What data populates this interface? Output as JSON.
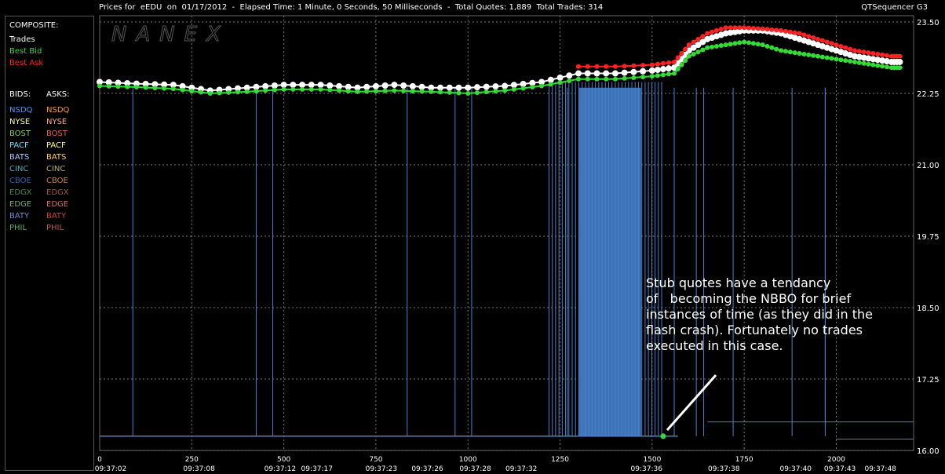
{
  "header": {
    "prices_for": "Prices for  eEDU  on  01/17/2012  -  Elapsed Time: 1 Minute, 0 Seconds, 50 Milliseconds  -  Total Quotes: 1,889  Total Trades: 314",
    "app_name": "QTSequencer G3"
  },
  "watermark": "NANEX",
  "legend": {
    "composite_label": "COMPOSITE:",
    "composite": [
      {
        "label": "Trades",
        "color": "#ffffff"
      },
      {
        "label": "Best Bid",
        "color": "#33dd33"
      },
      {
        "label": "Best Ask",
        "color": "#ff2222"
      }
    ],
    "bids_label": "BIDS:",
    "asks_label": "ASKS:",
    "exchanges": [
      {
        "bid": "NSDQ",
        "bid_color": "#5599ff",
        "ask": "NSDQ",
        "ask_color": "#ff9933"
      },
      {
        "bid": "NYSE",
        "bid_color": "#ffff99",
        "ask": "NYSE",
        "ask_color": "#ffaa88"
      },
      {
        "bid": "BOST",
        "bid_color": "#88cc55",
        "ask": "BOST",
        "ask_color": "#dd6655"
      },
      {
        "bid": "PACF",
        "bid_color": "#66ddff",
        "ask": "PACF",
        "ask_color": "#ffff66"
      },
      {
        "bid": "BATS",
        "bid_color": "#aaccff",
        "ask": "BATS",
        "ask_color": "#ffcc66"
      },
      {
        "bid": "CINC",
        "bid_color": "#55aabb",
        "ask": "CINC",
        "ask_color": "#bbaa66"
      },
      {
        "bid": "CBOE",
        "bid_color": "#3366aa",
        "ask": "CBOE",
        "ask_color": "#cc8833"
      },
      {
        "bid": "EDGX",
        "bid_color": "#448844",
        "ask": "EDGX",
        "ask_color": "#aa5533"
      },
      {
        "bid": "EDGE",
        "bid_color": "#77aa88",
        "ask": "EDGE",
        "ask_color": "#cc7766"
      },
      {
        "bid": "BATY",
        "bid_color": "#7788dd",
        "ask": "BATY",
        "ask_color": "#cc4433"
      },
      {
        "bid": "PHIL",
        "bid_color": "#66aa66",
        "ask": "PHIL",
        "ask_color": "#bb5555"
      }
    ]
  },
  "annotation": "Stub quotes have a tendancy\nof   becoming the NBBO for brief\ninstances of time (as they did in the\nflash crash). Fortunately no trades\nexecuted in this case.",
  "chart_data": {
    "type": "line",
    "ylim": [
      16.0,
      23.5
    ],
    "y_ticks": [
      "23.50",
      "22.25",
      "21.00",
      "19.75",
      "18.50",
      "17.25",
      "16.00"
    ],
    "y_tick_values": [
      23.5,
      22.25,
      21.0,
      19.75,
      18.5,
      17.25,
      16.0
    ],
    "xlim": [
      0,
      2210
    ],
    "x_ticks": [
      "0",
      "250",
      "500",
      "750",
      "1000",
      "1250",
      "1500",
      "1750",
      "2000"
    ],
    "x_tick_values": [
      0,
      250,
      500,
      750,
      1000,
      1250,
      1500,
      1750,
      2000
    ],
    "time_labels": [
      "09:37:02",
      "09:37:08",
      "09:37:12",
      "09:37:17",
      "09:37:23",
      "09:37:26",
      "09:37:28",
      "09:37:32",
      "09:37:36",
      "09:37:38",
      "09:37:40",
      "09:37:43",
      "09:37:48"
    ],
    "time_label_x": [
      0,
      240,
      460,
      560,
      735,
      860,
      990,
      1115,
      1455,
      1665,
      1860,
      1980,
      2090
    ],
    "grid": true,
    "series": [
      {
        "name": "Trades",
        "color": "#ffffff",
        "x": [
          0,
          100,
          200,
          300,
          400,
          500,
          600,
          700,
          800,
          900,
          1000,
          1100,
          1200,
          1300,
          1400,
          1500,
          1560,
          1600,
          1650,
          1700,
          1750,
          1800,
          1850,
          1900,
          1950,
          2000,
          2050,
          2100,
          2150,
          2180
        ],
        "y": [
          22.45,
          22.42,
          22.4,
          22.3,
          22.35,
          22.4,
          22.4,
          22.35,
          22.4,
          22.35,
          22.35,
          22.38,
          22.45,
          22.6,
          22.6,
          22.65,
          22.7,
          23.0,
          23.2,
          23.3,
          23.35,
          23.35,
          23.3,
          23.2,
          23.1,
          23.0,
          22.9,
          22.85,
          22.8,
          22.8
        ]
      },
      {
        "name": "Best Bid",
        "color": "#33dd33",
        "x": [
          0,
          100,
          200,
          300,
          400,
          500,
          600,
          700,
          800,
          900,
          1000,
          1100,
          1200,
          1300,
          1400,
          1500,
          1560,
          1600,
          1650,
          1700,
          1750,
          1800,
          1850,
          1900,
          1950,
          2000,
          2050,
          2100,
          2150,
          2180
        ],
        "y": [
          22.38,
          22.36,
          22.33,
          22.25,
          22.28,
          22.32,
          22.32,
          22.28,
          22.3,
          22.28,
          22.25,
          22.3,
          22.38,
          22.5,
          22.5,
          22.55,
          22.6,
          22.9,
          23.05,
          23.1,
          23.15,
          23.1,
          23.0,
          22.95,
          22.9,
          22.85,
          22.8,
          22.75,
          22.7,
          22.7
        ]
      },
      {
        "name": "Best Ask",
        "color": "#ff2222",
        "x": [
          1300,
          1400,
          1500,
          1560,
          1600,
          1650,
          1700,
          1750,
          1800,
          1850,
          1900,
          1950,
          2000,
          2050,
          2100,
          2150,
          2180
        ],
        "y": [
          22.72,
          22.72,
          22.75,
          22.8,
          23.1,
          23.3,
          23.4,
          23.4,
          23.38,
          23.35,
          23.3,
          23.2,
          23.1,
          23.0,
          22.95,
          22.9,
          22.9
        ]
      }
    ],
    "stub_bid_low": 16.25,
    "stub_bid_x_ranges": [
      [
        0,
        1570
      ]
    ],
    "stub_drop_x": [
      90,
      425,
      470,
      835,
      965,
      1010,
      1270,
      1318,
      1560,
      1620,
      1640,
      1720,
      1880,
      1970
    ],
    "dense_blue_range": [
      1300,
      1470
    ],
    "stub_trade_point": {
      "x": 1530,
      "y": 16.25,
      "color": "#33dd33"
    }
  }
}
